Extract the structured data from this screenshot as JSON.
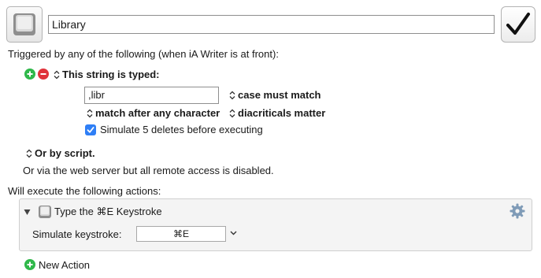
{
  "macro": {
    "name": "Library",
    "icon": "keyboard-key-icon",
    "enabled_icon": "checkmark-icon"
  },
  "triggers": {
    "header": "Triggered by any of the following (when iA Writer is at front):",
    "string_trigger": {
      "label": "This string is typed:",
      "value": ",libr",
      "case_label": "case must match",
      "match_label": "match after any character",
      "diacriticals_label": "diacriticals matter",
      "simulate_checked": true,
      "simulate_label": "Simulate 5 deletes before executing"
    },
    "script_label": "Or by script.",
    "web_server_text": "Or via the web server but all remote access is disabled."
  },
  "actions": {
    "header": "Will execute the following actions:",
    "items": [
      {
        "title": "Type the ⌘E Keystroke",
        "simulate_label": "Simulate keystroke:",
        "keystroke": "⌘E"
      }
    ],
    "new_action_label": "New Action"
  },
  "colors": {
    "add_green": "#2fb84a",
    "remove_red": "#e0333b",
    "checkbox_blue": "#2f7ff6"
  }
}
